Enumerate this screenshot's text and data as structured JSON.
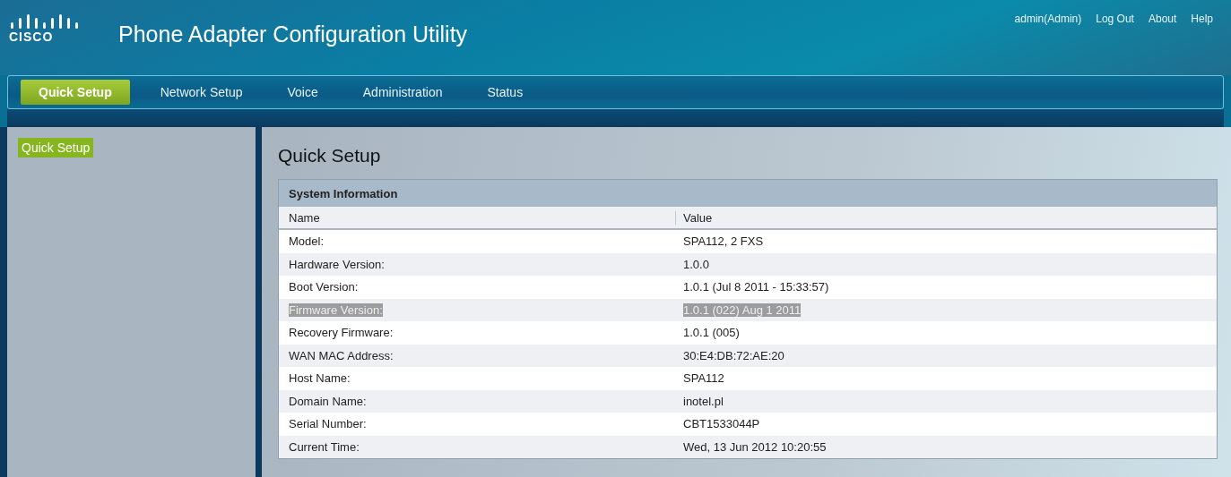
{
  "header": {
    "logo": "CISCO",
    "title": "Phone Adapter Configuration Utility",
    "user_links": [
      {
        "label": "admin(Admin)"
      },
      {
        "label": "Log Out"
      },
      {
        "label": "About"
      },
      {
        "label": "Help"
      }
    ]
  },
  "tabs": [
    {
      "label": "Quick Setup",
      "selected": true
    },
    {
      "label": "Network Setup",
      "selected": false
    },
    {
      "label": "Voice",
      "selected": false
    },
    {
      "label": "Administration",
      "selected": false
    },
    {
      "label": "Status",
      "selected": false
    }
  ],
  "sidebar": {
    "items": [
      {
        "label": "Quick Setup",
        "selected": true
      }
    ]
  },
  "page_title": "Quick Setup",
  "table": {
    "title": "System Information",
    "columns": [
      "Name",
      "Value"
    ],
    "rows": [
      {
        "name": "Model:",
        "value": "SPA112, 2 FXS",
        "selected": false
      },
      {
        "name": "Hardware Version:",
        "value": "1.0.0",
        "selected": false
      },
      {
        "name": "Boot Version:",
        "value": "1.0.1 (Jul 8 2011 - 15:33:57)",
        "selected": false
      },
      {
        "name": "Firmware Version:",
        "value": "1.0.1 (022) Aug 1 2011",
        "selected": true
      },
      {
        "name": "Recovery Firmware:",
        "value": "1.0.1 (005)",
        "selected": false
      },
      {
        "name": "WAN MAC Address:",
        "value": "30:E4:DB:72:AE:20",
        "selected": false
      },
      {
        "name": "Host Name:",
        "value": "SPA112",
        "selected": false
      },
      {
        "name": "Domain Name:",
        "value": "inotel.pl",
        "selected": false
      },
      {
        "name": "Serial Number:",
        "value": "CBT1533044P",
        "selected": false
      },
      {
        "name": "Current Time:",
        "value": "Wed, 13 Jun 2012 10:20:55",
        "selected": false
      }
    ]
  }
}
